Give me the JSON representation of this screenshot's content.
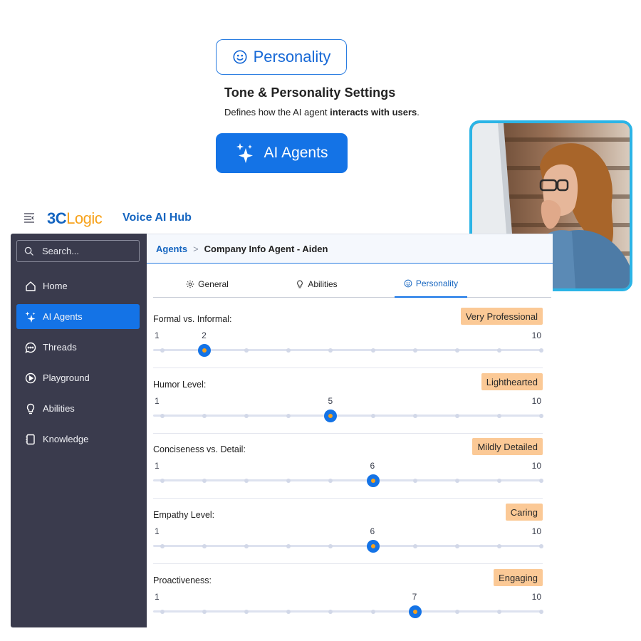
{
  "hero": {
    "personality_pill": "Personality",
    "title": "Tone & Personality Settings",
    "subtitle_prefix": "Defines how the AI agent ",
    "subtitle_bold": "interacts with users",
    "subtitle_suffix": ".",
    "ai_agents_pill": "AI Agents"
  },
  "app": {
    "logo_3c": "3C",
    "logo_logic": "Logic",
    "hub_title": "Voice AI Hub"
  },
  "sidebar": {
    "search_placeholder": "Search...",
    "items": [
      {
        "label": "Home",
        "icon": "home-icon",
        "active": false
      },
      {
        "label": "AI Agents",
        "icon": "sparkle-icon",
        "active": true
      },
      {
        "label": "Threads",
        "icon": "chat-icon",
        "active": false
      },
      {
        "label": "Playground",
        "icon": "play-icon",
        "active": false
      },
      {
        "label": "Abilities",
        "icon": "bulb-icon",
        "active": false
      },
      {
        "label": "Knowledge",
        "icon": "book-icon",
        "active": false
      }
    ]
  },
  "breadcrumb": {
    "root": "Agents",
    "separator": ">",
    "current": "Company Info Agent - Aiden"
  },
  "tabs": [
    {
      "label": "General",
      "icon": "gear-icon",
      "active": false
    },
    {
      "label": "Abilities",
      "icon": "bulb-icon",
      "active": false
    },
    {
      "label": "Personality",
      "icon": "smile-icon",
      "active": true
    }
  ],
  "sliders": [
    {
      "label": "Formal vs. Informal:",
      "badge": "Very Professional",
      "min": "1",
      "max": "10",
      "value": 2
    },
    {
      "label": "Humor Level:",
      "badge": "Lighthearted",
      "min": "1",
      "max": "10",
      "value": 5
    },
    {
      "label": "Conciseness vs. Detail:",
      "badge": "Mildly Detailed",
      "min": "1",
      "max": "10",
      "value": 6
    },
    {
      "label": "Empathy Level:",
      "badge": "Caring",
      "min": "1",
      "max": "10",
      "value": 6
    },
    {
      "label": "Proactiveness:",
      "badge": "Engaging",
      "min": "1",
      "max": "10",
      "value": 7
    }
  ],
  "colors": {
    "accent": "#1473e6",
    "sidebar": "#3a3b4d",
    "badge": "#fbc996",
    "logo_orange": "#f7a21b"
  }
}
